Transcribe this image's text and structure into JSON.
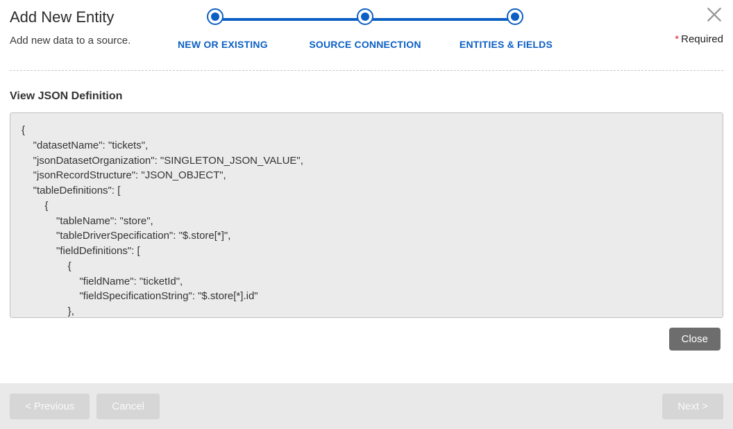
{
  "dialog": {
    "title": "Add New Entity",
    "subtitle": "Add new data to a source.",
    "required_label": "Required"
  },
  "stepper": {
    "steps": [
      {
        "label": "NEW OR EXISTING"
      },
      {
        "label": "SOURCE CONNECTION"
      },
      {
        "label": "ENTITIES & FIELDS"
      }
    ]
  },
  "section": {
    "title": "View JSON Definition"
  },
  "json_text": "{\n    \"datasetName\": \"tickets\",\n    \"jsonDatasetOrganization\": \"SINGLETON_JSON_VALUE\",\n    \"jsonRecordStructure\": \"JSON_OBJECT\",\n    \"tableDefinitions\": [\n        {\n            \"tableName\": \"store\",\n            \"tableDriverSpecification\": \"$.store[*]\",\n            \"fieldDefinitions\": [\n                {\n                    \"fieldName\": \"ticketId\",\n                    \"fieldSpecificationString\": \"$.store[*].id\"\n                },",
  "buttons": {
    "close": "Close",
    "previous": "< Previous",
    "cancel": "Cancel",
    "next": "Next >"
  }
}
